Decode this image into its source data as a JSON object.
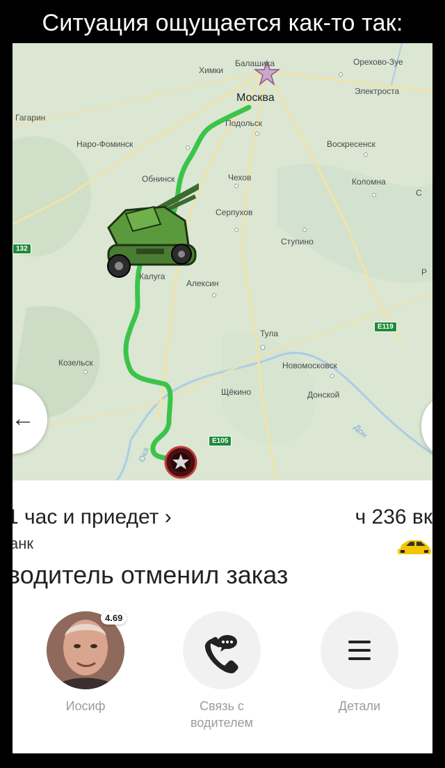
{
  "caption": "Ситуация ощущается как-то так:",
  "map": {
    "cities": {
      "balashikha": "Балашиха",
      "orekhovo": "Орехово-Зуе",
      "khimki": "Химки",
      "moscow": "Москва",
      "elektrostal": "Электроста",
      "gagarin": "Гагарин",
      "podolsk": "Подольск",
      "naro": "Наро-Фоминск",
      "voskresensk": "Воскресенск",
      "obninsk": "Обнинск",
      "chekhov": "Чехов",
      "kolomna": "Коломна",
      "serpukhov": "Серпухов",
      "stupino": "Ступино",
      "kaluga": "Калуга",
      "aleksin": "Алексин",
      "tula": "Тула",
      "kozelsk": "Козельск",
      "novomoskovsk": "Новомосковск",
      "shchekino": "Щёкино",
      "donskoy": "Донской",
      "oka": "Ока",
      "don": "Дон",
      "edge_c": "С",
      "edge_r": "Р"
    },
    "road_badges": {
      "e119": "Е119",
      "e105": "Е105",
      "r132": "132"
    },
    "route_color": "#3bc44a",
    "destination_icon": "star-marker-icon",
    "vehicle_icon": "tank-icon"
  },
  "sheet": {
    "eta": "1 час и приедет ›",
    "price": "ч 236 вк",
    "car_class": "анк",
    "status": "водитель отменил заказ",
    "driver": {
      "name": "Иосиф",
      "rating": "4.69",
      "avatar_icon": "driver-avatar"
    },
    "contact": {
      "label_line1": "Связь с",
      "label_line2": "водителем",
      "icon": "phone-message-icon"
    },
    "details": {
      "label": "Детали",
      "icon": "menu-icon"
    }
  }
}
